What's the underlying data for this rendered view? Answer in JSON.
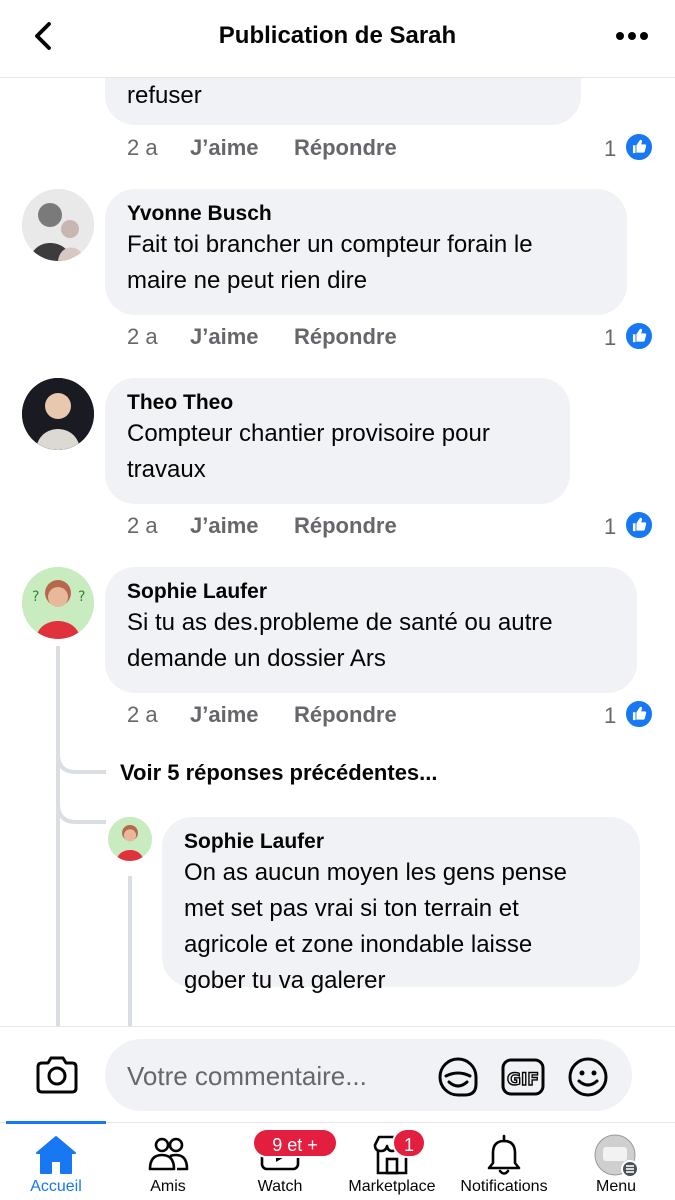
{
  "header": {
    "title": "Publication de Sarah"
  },
  "comments": [
    {
      "author": "",
      "text_lines": [
        "refuser"
      ],
      "time": "2 a",
      "like_label": "J’aime",
      "reply_label": "Répondre",
      "reactions": "1"
    },
    {
      "author": "Yvonne Busch",
      "text_lines": [
        "Fait toi brancher un compteur forain  le",
        "maire ne peut rien dire"
      ],
      "time": "2 a",
      "like_label": "J’aime",
      "reply_label": "Répondre",
      "reactions": "1"
    },
    {
      "author": "Theo Theo",
      "text_lines": [
        "Compteur chantier provisoire pour",
        "travaux"
      ],
      "time": "2 a",
      "like_label": "J’aime",
      "reply_label": "Répondre",
      "reactions": "1"
    },
    {
      "author": "Sophie Laufer",
      "text_lines": [
        "Si tu as des.probleme de santé ou autre",
        "demande un dossier Ars"
      ],
      "time": "2 a",
      "like_label": "J’aime",
      "reply_label": "Répondre",
      "reactions": "1"
    }
  ],
  "view_more_replies": "Voir 5 réponses précédentes...",
  "reply": {
    "author": "Sophie Laufer",
    "text_lines": [
      "On as aucun moyen les gens pense",
      "met set pas vrai si ton terrain et",
      "agricole et zone inondable laisse",
      "gober tu va galerer"
    ]
  },
  "composer": {
    "placeholder": "Votre commentaire..."
  },
  "nav": {
    "items": [
      {
        "label": "Accueil",
        "icon": "home-icon",
        "active": true
      },
      {
        "label": "Amis",
        "icon": "friends-icon"
      },
      {
        "label": "Watch",
        "icon": "watch-icon",
        "badge": "9 et +"
      },
      {
        "label": "Marketplace",
        "icon": "marketplace-icon",
        "badge": "1"
      },
      {
        "label": "Notifications",
        "icon": "bell-icon"
      },
      {
        "label": "Menu",
        "icon": "menu-avatar-icon"
      }
    ]
  },
  "colors": {
    "accent": "#1877f2",
    "badge": "#e41e3f",
    "bubble": "#f0f2f5",
    "secondary_text": "#65676b"
  }
}
